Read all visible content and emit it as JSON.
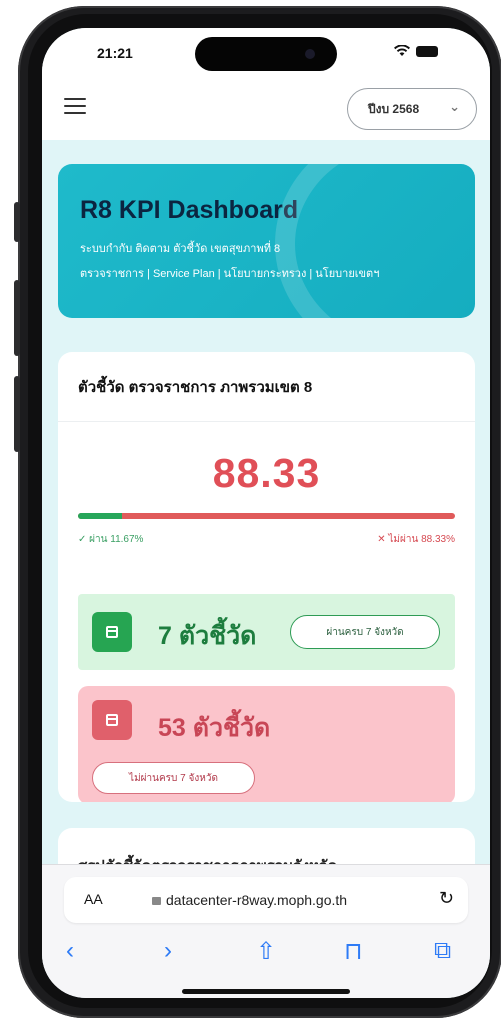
{
  "status_bar": {
    "time": "21:21"
  },
  "topbar": {
    "year_select": "ปีงบ 2568"
  },
  "hero": {
    "title": "R8 KPI Dashboard",
    "subtitle_1": "ระบบกำกับ ติดตาม ตัวชี้วัด เขตสุขภาพที่ 8",
    "subtitle_2": "ตรวจราชการ | Service Plan | นโยบายกระทรวง | นโยบายเขตฯ"
  },
  "kpi_card": {
    "heading": "ตัวชี้วัด ตรวจราชการ ภาพรวมเขต 8",
    "score": "88.33",
    "pass_fraction": 0.1167,
    "pass_label": "✓ ผ่าน 11.67%",
    "fail_label": "✕ ไม่ผ่าน 88.33%",
    "pass_count": "7 ตัวชี้วัด",
    "pass_chip": "ผ่านครบ 7 จังหวัด",
    "fail_count": "53 ตัวชี้วัด",
    "fail_chip": "ไม่ผ่านครบ 7 จังหวัด"
  },
  "next_card": {
    "heading": "สรุปตัวชี้วัดตรวจราชการภาพรวมจังหวัด"
  },
  "safari": {
    "aa": "AA",
    "url": "datacenter-r8way.moph.go.th",
    "reload": "↻",
    "back": "‹",
    "forward": "›",
    "share": "⇧",
    "bookmarks": "⊓",
    "tabs": "⧉"
  },
  "colors": {
    "accent_teal": "#1fbacb",
    "score_red": "#e04f57",
    "pass_green": "#26a552",
    "fail_pink": "#fbc4cb"
  }
}
